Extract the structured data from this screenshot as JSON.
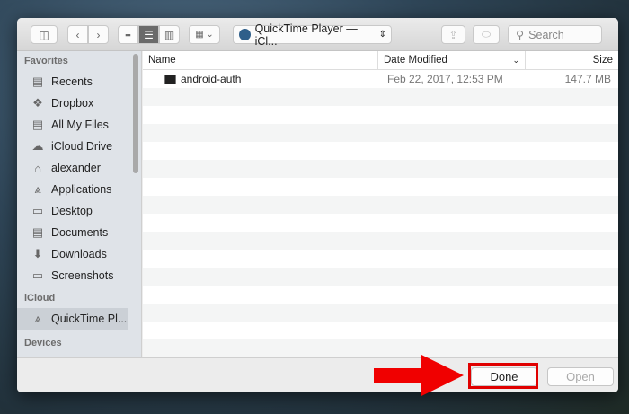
{
  "toolbar": {
    "location": "QuickTime Player — iCl...",
    "search_placeholder": "Search"
  },
  "sidebar": {
    "sections": [
      {
        "title": "Favorites",
        "items": [
          {
            "label": "Recents",
            "icon": "recents-icon",
            "glyph": "▤"
          },
          {
            "label": "Dropbox",
            "icon": "dropbox-icon",
            "glyph": "❖"
          },
          {
            "label": "All My Files",
            "icon": "all-files-icon",
            "glyph": "▤"
          },
          {
            "label": "iCloud Drive",
            "icon": "cloud-icon",
            "glyph": "☁"
          },
          {
            "label": "alexander",
            "icon": "home-icon",
            "glyph": "⌂"
          },
          {
            "label": "Applications",
            "icon": "applications-icon",
            "glyph": "⩓"
          },
          {
            "label": "Desktop",
            "icon": "desktop-icon",
            "glyph": "▭"
          },
          {
            "label": "Documents",
            "icon": "documents-icon",
            "glyph": "▤"
          },
          {
            "label": "Downloads",
            "icon": "downloads-icon",
            "glyph": "⬇"
          },
          {
            "label": "Screenshots",
            "icon": "folder-icon",
            "glyph": "▭"
          }
        ]
      },
      {
        "title": "iCloud",
        "items": [
          {
            "label": "QuickTime Pl...",
            "icon": "applications-icon",
            "glyph": "⩓"
          }
        ]
      },
      {
        "title": "Devices",
        "items": []
      }
    ]
  },
  "columns": {
    "name": "Name",
    "date": "Date Modified",
    "size": "Size"
  },
  "files": [
    {
      "name": "android-auth",
      "date": "Feb 22, 2017, 12:53 PM",
      "size": "147.7 MB"
    }
  ],
  "buttons": {
    "done": "Done",
    "open": "Open"
  },
  "colors": {
    "highlight": "#e00000"
  }
}
